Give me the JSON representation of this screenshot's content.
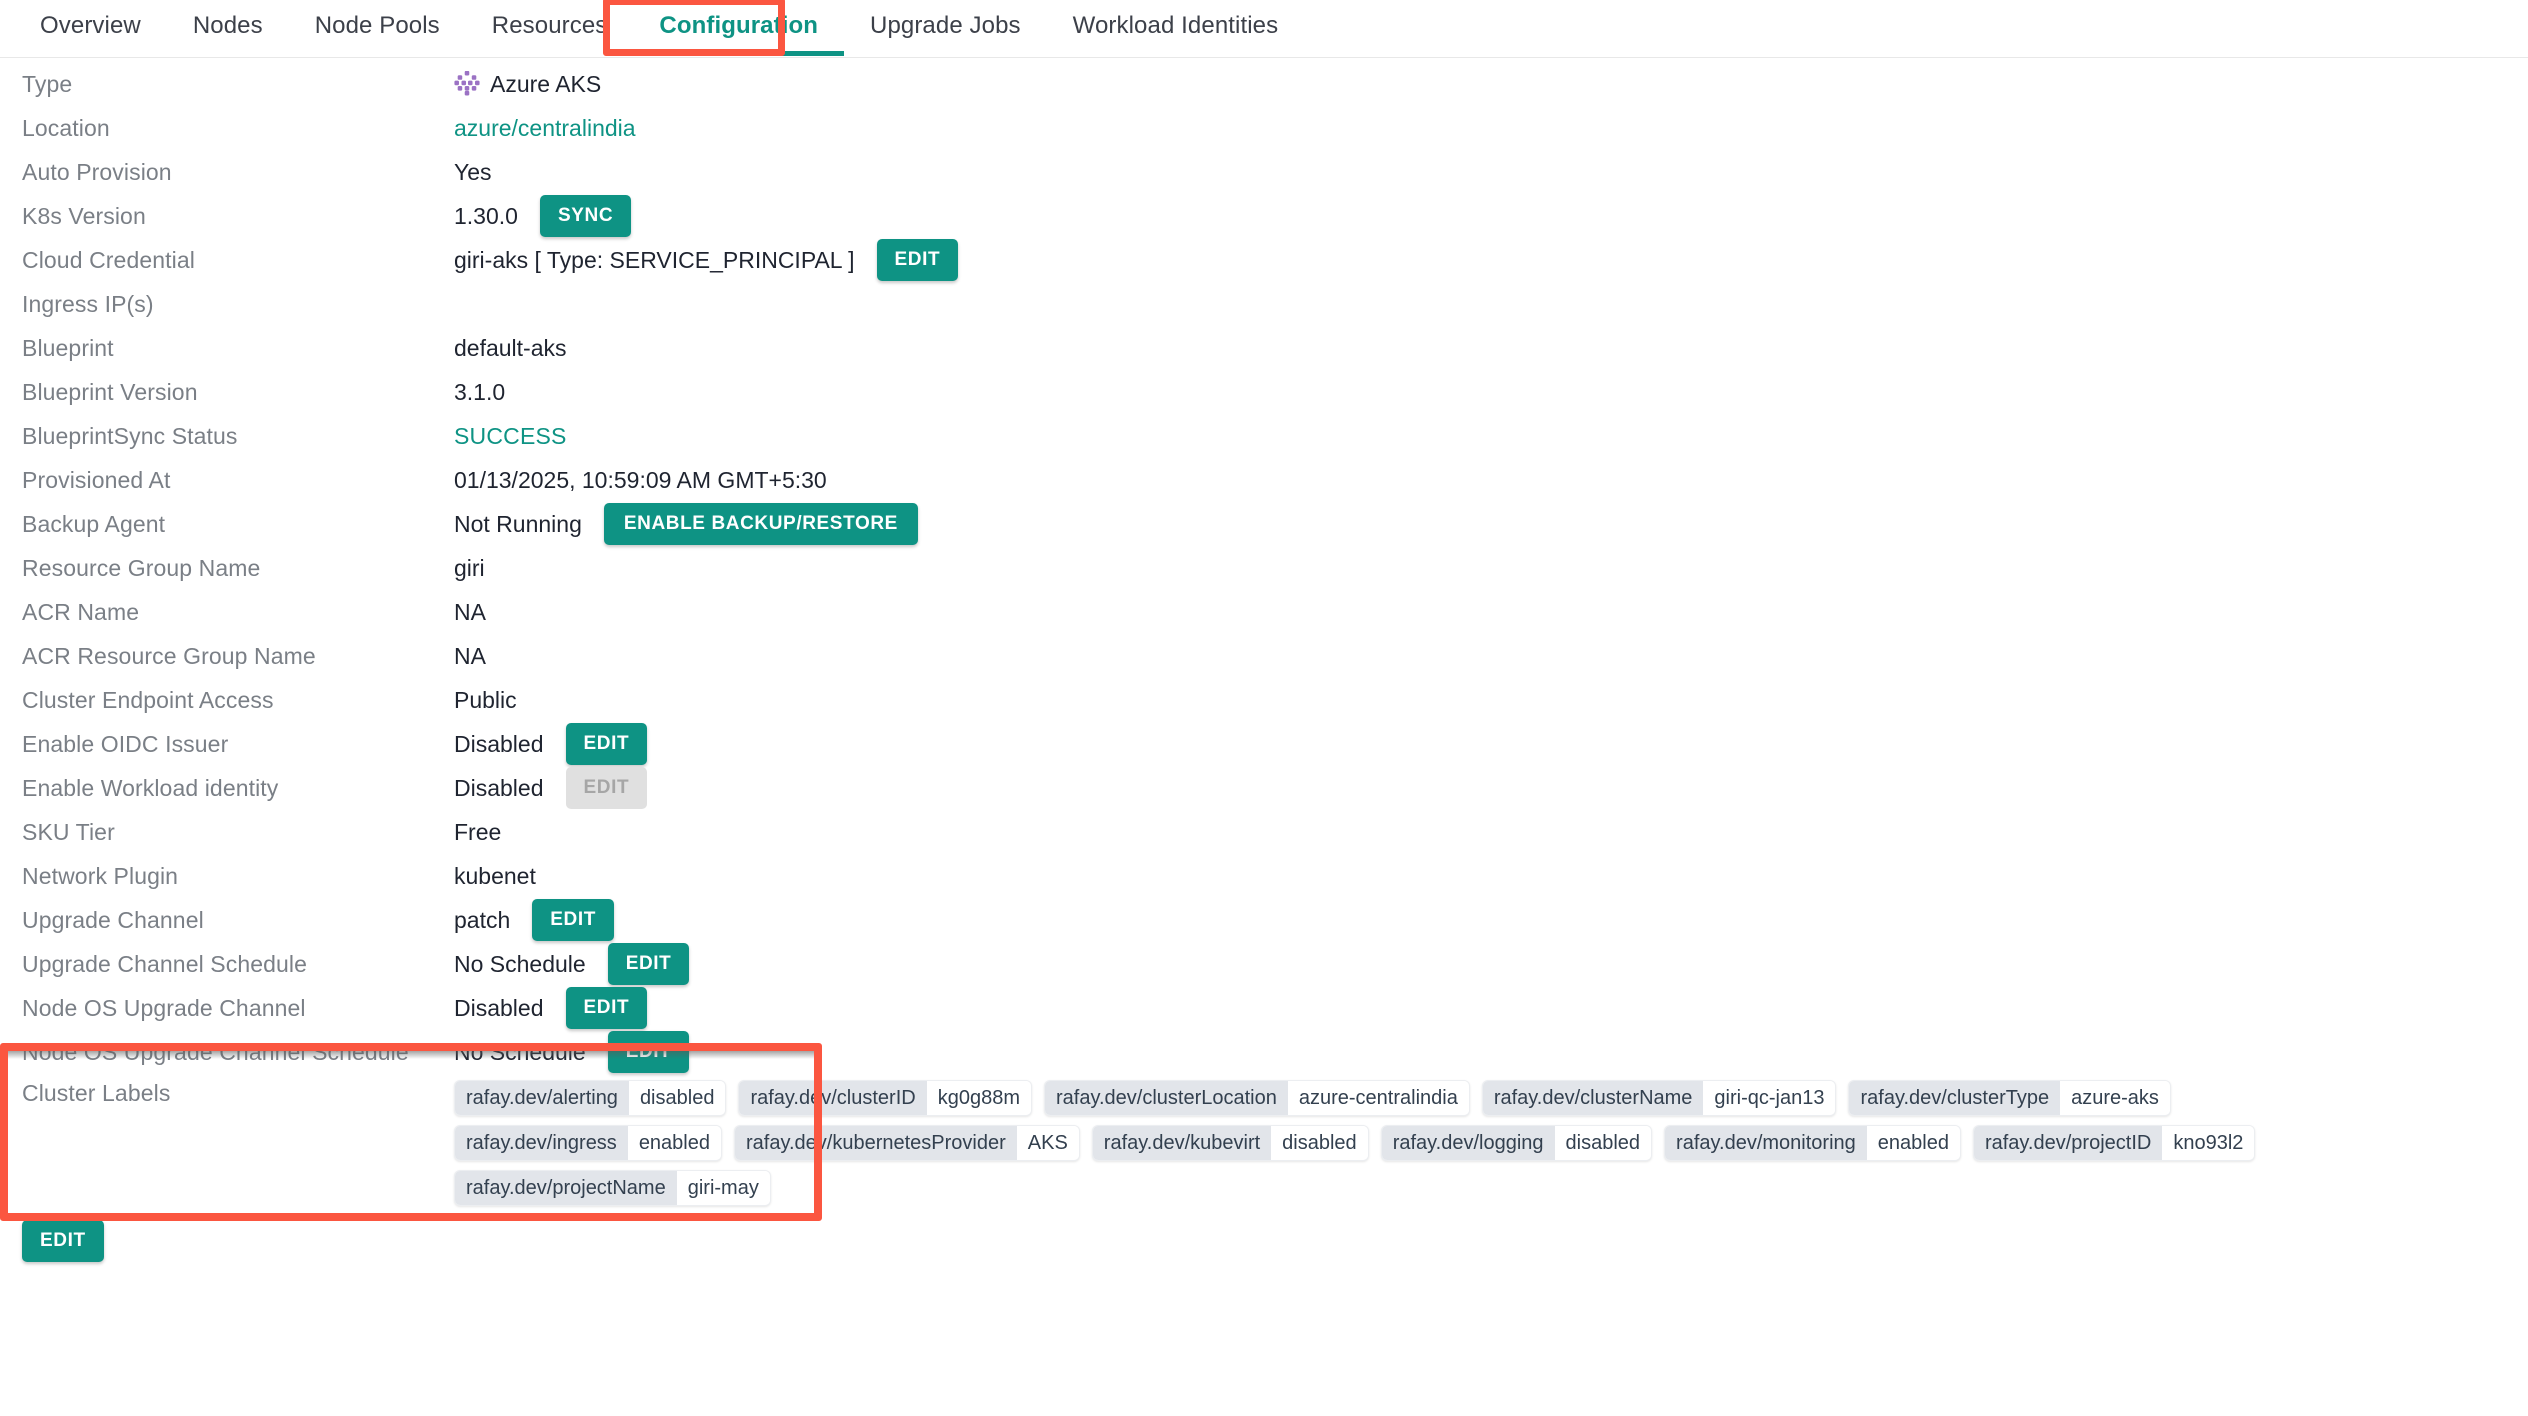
{
  "tabs": [
    {
      "label": "Overview",
      "active": false
    },
    {
      "label": "Nodes",
      "active": false
    },
    {
      "label": "Node Pools",
      "active": false
    },
    {
      "label": "Resources",
      "active": false
    },
    {
      "label": "Configuration",
      "active": true
    },
    {
      "label": "Upgrade Jobs",
      "active": false
    },
    {
      "label": "Workload Identities",
      "active": false
    }
  ],
  "colors": {
    "accent_teal": "#0e9384",
    "annotation_red": "#fb5640",
    "label_gray": "#7a7f86",
    "chip_key_bg": "#e2e5ea"
  },
  "config_rows": [
    {
      "label": "Type",
      "value": "Azure AKS",
      "icon": "azure-aks-icon"
    },
    {
      "label": "Location",
      "value": "azure/centralindia",
      "style": "link"
    },
    {
      "label": "Auto Provision",
      "value": "Yes"
    },
    {
      "label": "K8s Version",
      "value": "1.30.0",
      "button": "SYNC"
    },
    {
      "label": "Cloud Credential",
      "value": "giri-aks [ Type: SERVICE_PRINCIPAL ]",
      "button": "EDIT"
    },
    {
      "label": "Ingress IP(s)",
      "value": ""
    },
    {
      "label": "Blueprint",
      "value": "default-aks"
    },
    {
      "label": "Blueprint Version",
      "value": "3.1.0"
    },
    {
      "label": "BlueprintSync Status",
      "value": "SUCCESS",
      "style": "success"
    },
    {
      "label": "Provisioned At",
      "value": "01/13/2025, 10:59:09 AM GMT+5:30"
    },
    {
      "label": "Backup Agent",
      "value": "Not Running",
      "button": "ENABLE BACKUP/RESTORE"
    },
    {
      "label": "Resource Group Name",
      "value": "giri"
    },
    {
      "label": "ACR Name",
      "value": "NA"
    },
    {
      "label": "ACR Resource Group Name",
      "value": "NA"
    },
    {
      "label": "Cluster Endpoint Access",
      "value": "Public"
    },
    {
      "label": "Enable OIDC Issuer",
      "value": "Disabled",
      "button": "EDIT"
    },
    {
      "label": "Enable Workload identity",
      "value": "Disabled",
      "button": "EDIT",
      "button_disabled": true
    },
    {
      "label": "SKU Tier",
      "value": "Free"
    },
    {
      "label": "Network Plugin",
      "value": "kubenet"
    }
  ],
  "highlighted_rows": [
    {
      "label": "Upgrade Channel",
      "value": "patch",
      "button": "EDIT"
    },
    {
      "label": "Upgrade Channel Schedule",
      "value": "No Schedule",
      "button": "EDIT"
    },
    {
      "label": "Node OS Upgrade Channel",
      "value": "Disabled",
      "button": "EDIT"
    },
    {
      "label": "Node OS Upgrade Channel Schedule",
      "value": "No Schedule",
      "button": "EDIT"
    }
  ],
  "cluster_labels": {
    "label": "Cluster Labels",
    "edit_button": "EDIT",
    "lines": [
      [
        {
          "key": "rafay.dev/alerting",
          "value": "disabled"
        },
        {
          "key": "rafay.dev/clusterID",
          "value": "kg0g88m"
        },
        {
          "key": "rafay.dev/clusterLocation",
          "value": "azure-centralindia"
        },
        {
          "key": "rafay.dev/clusterName",
          "value": "giri-qc-jan13"
        },
        {
          "key": "rafay.dev/clusterType",
          "value": "azure-aks"
        }
      ],
      [
        {
          "key": "rafay.dev/ingress",
          "value": "enabled"
        },
        {
          "key": "rafay.dev/kubernetesProvider",
          "value": "AKS"
        },
        {
          "key": "rafay.dev/kubevirt",
          "value": "disabled"
        },
        {
          "key": "rafay.dev/logging",
          "value": "disabled"
        },
        {
          "key": "rafay.dev/monitoring",
          "value": "enabled"
        },
        {
          "key": "rafay.dev/projectID",
          "value": "kno93l2"
        }
      ],
      [
        {
          "key": "rafay.dev/projectName",
          "value": "giri-may"
        }
      ]
    ]
  }
}
